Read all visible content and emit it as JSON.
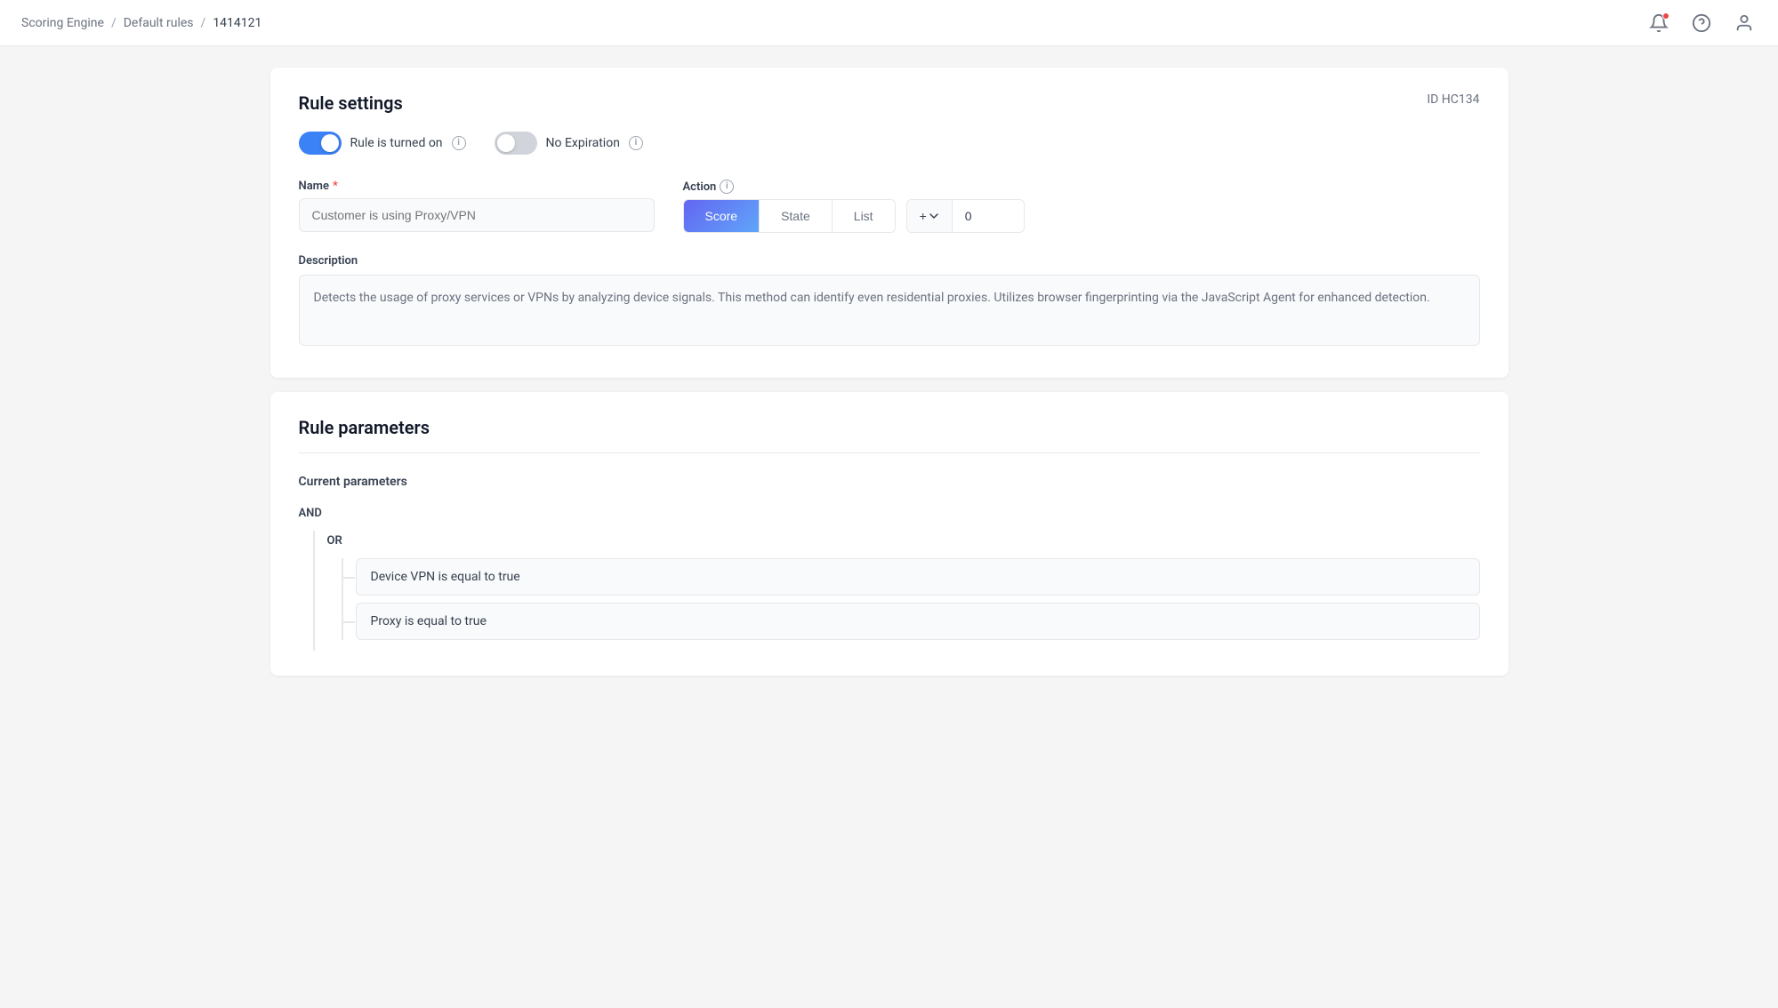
{
  "nav": {
    "breadcrumbs": [
      {
        "label": "Scoring Engine",
        "id": "scoring-engine"
      },
      {
        "label": "Default rules",
        "id": "default-rules"
      },
      {
        "label": "1414121",
        "id": "rule-id-breadcrumb"
      }
    ],
    "icons": {
      "bell": "🔔",
      "help": "?",
      "user": "👤"
    }
  },
  "rule_settings": {
    "title": "Rule settings",
    "rule_id": "ID HC134",
    "toggle_on_label": "Rule is turned on",
    "toggle_on_state": true,
    "no_expiration_label": "No Expiration",
    "no_expiration_state": false,
    "name_label": "Name",
    "name_required": true,
    "name_placeholder": "Customer is using Proxy/VPN",
    "action_label": "Action",
    "action_tabs": [
      "Score",
      "State",
      "List"
    ],
    "active_tab": "Score",
    "score_modifier": "+",
    "score_value": "0",
    "description_label": "Description",
    "description_text": "Detects the usage of proxy services or VPNs by analyzing device signals. This method can identify even residential proxies. Utilizes browser fingerprinting via the JavaScript Agent for enhanced detection."
  },
  "rule_parameters": {
    "title": "Rule parameters",
    "current_params_label": "Current parameters",
    "and_label": "AND",
    "or_label": "OR",
    "conditions": [
      "Device VPN is equal to true",
      "Proxy is equal to true"
    ]
  }
}
